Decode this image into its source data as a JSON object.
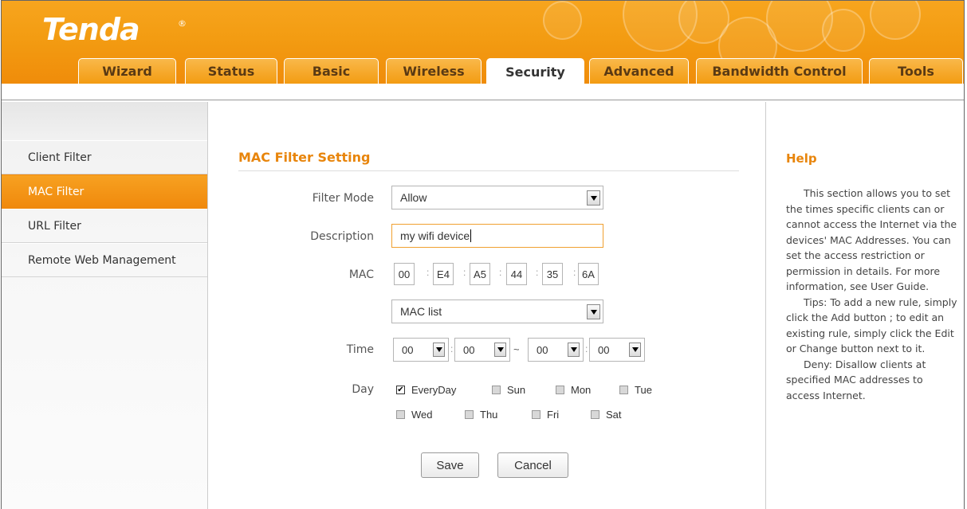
{
  "brand": {
    "logo_text": "Tenda",
    "logo_mark": "®"
  },
  "nav": {
    "tabs": [
      {
        "label": "Wizard"
      },
      {
        "label": "Status"
      },
      {
        "label": "Basic"
      },
      {
        "label": "Wireless"
      },
      {
        "label": "Security"
      },
      {
        "label": "Advanced"
      },
      {
        "label": "Bandwidth Control"
      },
      {
        "label": "Tools"
      }
    ],
    "active_tab": "Security"
  },
  "sidebar": {
    "items": [
      {
        "label": "Client Filter"
      },
      {
        "label": "MAC Filter"
      },
      {
        "label": "URL Filter"
      },
      {
        "label": "Remote Web Management"
      }
    ],
    "active_item": "MAC Filter"
  },
  "form": {
    "section_title": "MAC Filter Setting",
    "filter_mode": {
      "label": "Filter Mode",
      "value": "Allow"
    },
    "description": {
      "label": "Description",
      "value": "my wifi device"
    },
    "mac": {
      "label": "MAC",
      "octets": [
        "00",
        "E4",
        "A5",
        "44",
        "35",
        "6A"
      ],
      "separator": ":"
    },
    "mac_list": {
      "value": "MAC list"
    },
    "time": {
      "label": "Time",
      "start_hour": "00",
      "start_min": "00",
      "end_hour": "00",
      "end_min": "00",
      "separator": ":",
      "range_sep": "~"
    },
    "day": {
      "label": "Day",
      "everyday": {
        "label": "EveryDay",
        "checked": true
      },
      "days": [
        {
          "label": "Sun",
          "checked": false
        },
        {
          "label": "Mon",
          "checked": false
        },
        {
          "label": "Tue",
          "checked": false
        },
        {
          "label": "Wed",
          "checked": false
        },
        {
          "label": "Thu",
          "checked": false
        },
        {
          "label": "Fri",
          "checked": false
        },
        {
          "label": "Sat",
          "checked": false
        }
      ],
      "check_glyph": "✔"
    },
    "buttons": {
      "save": "Save",
      "cancel": "Cancel"
    }
  },
  "help": {
    "title": "Help",
    "paragraphs": [
      "This section allows you to set the times specific clients can or cannot access the Internet via the devices' MAC Addresses. You can set the access restriction or permission in details. For more information, see User Guide.",
      "Tips: To add a new rule, simply click the Add button ; to edit an existing rule, simply click the Edit or Change button next to it.",
      "Deny: Disallow clients at specified MAC addresses to access Internet."
    ]
  },
  "colors": {
    "accent": "#f39c12",
    "title": "#e8850c"
  }
}
